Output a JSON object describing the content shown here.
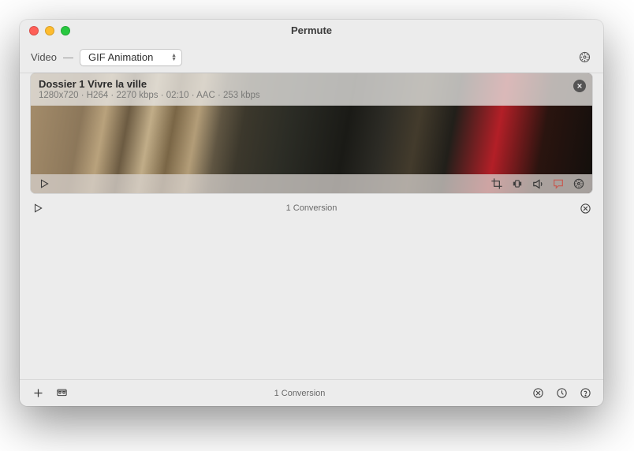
{
  "app": {
    "title": "Permute"
  },
  "toolbar": {
    "category_label": "Video",
    "preset_selected": "GIF Animation"
  },
  "item": {
    "title": "Dossier 1 Vivre la ville",
    "meta": "1280x720 · H264 · 2270 kbps · 02:10 · AAC · 253 kbps"
  },
  "status": {
    "label": "1 Conversion"
  },
  "bottom": {
    "label": "1 Conversion"
  }
}
